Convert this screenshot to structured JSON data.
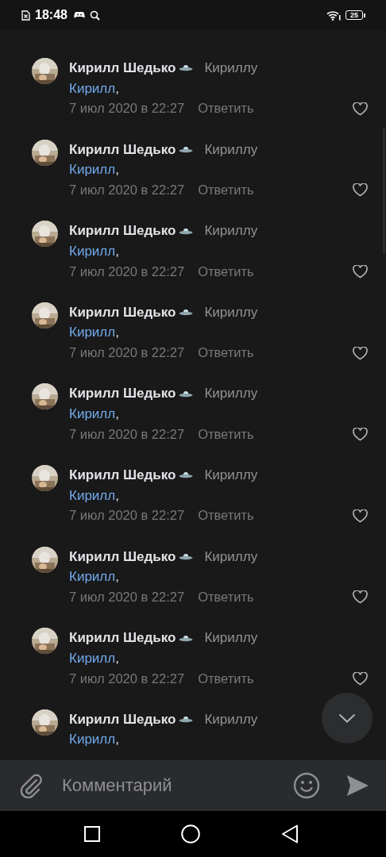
{
  "status_bar": {
    "time": "18:48",
    "battery": "25"
  },
  "comments": [
    {
      "author": "Кирилл Шедько",
      "reply_to": "Кириллу",
      "mention": "Кирилл",
      "text": ",",
      "date": "7 июл 2020 в 22:27",
      "reply": "Ответить"
    },
    {
      "author": "Кирилл Шедько",
      "reply_to": "Кириллу",
      "mention": "Кирилл",
      "text": ",",
      "date": "7 июл 2020 в 22:27",
      "reply": "Ответить"
    },
    {
      "author": "Кирилл Шедько",
      "reply_to": "Кириллу",
      "mention": "Кирилл",
      "text": ",",
      "date": "7 июл 2020 в 22:27",
      "reply": "Ответить"
    },
    {
      "author": "Кирилл Шедько",
      "reply_to": "Кириллу",
      "mention": "Кирилл",
      "text": ",",
      "date": "7 июл 2020 в 22:27",
      "reply": "Ответить"
    },
    {
      "author": "Кирилл Шедько",
      "reply_to": "Кириллу",
      "mention": "Кирилл",
      "text": ",",
      "date": "7 июл 2020 в 22:27",
      "reply": "Ответить"
    },
    {
      "author": "Кирилл Шедько",
      "reply_to": "Кириллу",
      "mention": "Кирилл",
      "text": ",",
      "date": "7 июл 2020 в 22:27",
      "reply": "Ответить"
    },
    {
      "author": "Кирилл Шедько",
      "reply_to": "Кириллу",
      "mention": "Кирилл",
      "text": ",",
      "date": "7 июл 2020 в 22:27",
      "reply": "Ответить"
    },
    {
      "author": "Кирилл Шедько",
      "reply_to": "Кириллу",
      "mention": "Кирилл",
      "text": ",",
      "date": "7 июл 2020 в 22:27",
      "reply": "Ответить"
    },
    {
      "author": "Кирилл Шедько",
      "reply_to": "Кириллу",
      "mention": "Кирилл",
      "text": ","
    }
  ],
  "comment_bar": {
    "placeholder": "Комментарий"
  }
}
